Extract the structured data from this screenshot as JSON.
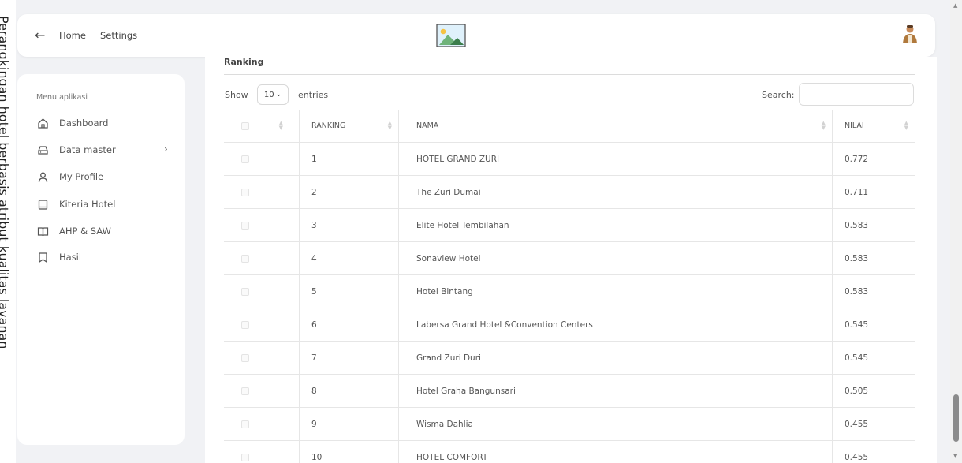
{
  "side_text": "Perangkingan hotel berbasis atribut kualitas layanan",
  "header": {
    "nav": {
      "home": "Home",
      "settings": "Settings"
    }
  },
  "sidebar": {
    "title": "Menu aplikasi",
    "items": [
      {
        "label": "Dashboard",
        "icon": "home-icon"
      },
      {
        "label": "Data master",
        "icon": "drive-icon",
        "has_submenu": true
      },
      {
        "label": "My Profile",
        "icon": "user-icon"
      },
      {
        "label": "Kiteria Hotel",
        "icon": "tablet-icon"
      },
      {
        "label": "AHP & SAW",
        "icon": "book-open-icon"
      },
      {
        "label": "Hasil",
        "icon": "bookmark-icon"
      }
    ]
  },
  "content": {
    "section_title": "Ranking",
    "show_label": "Show",
    "entries_value": "10",
    "entries_label": "entries",
    "search_label": "Search:",
    "columns": [
      "RANKING",
      "NAMA",
      "NILAI"
    ],
    "rows": [
      {
        "ranking": "1",
        "nama": "HOTEL GRAND ZURI",
        "nilai": "0.772"
      },
      {
        "ranking": "2",
        "nama": "The Zuri Dumai",
        "nilai": "0.711"
      },
      {
        "ranking": "3",
        "nama": "Elite Hotel Tembilahan",
        "nilai": "0.583"
      },
      {
        "ranking": "4",
        "nama": "Sonaview Hotel",
        "nilai": "0.583"
      },
      {
        "ranking": "5",
        "nama": "Hotel Bintang",
        "nilai": "0.583"
      },
      {
        "ranking": "6",
        "nama": "Labersa Grand Hotel &Convention Centers",
        "nilai": "0.545"
      },
      {
        "ranking": "7",
        "nama": "Grand Zuri Duri",
        "nilai": "0.545"
      },
      {
        "ranking": "8",
        "nama": "Hotel Graha Bangunsari",
        "nilai": "0.505"
      },
      {
        "ranking": "9",
        "nama": "Wisma Dahlia",
        "nilai": "0.455"
      },
      {
        "ranking": "10",
        "nama": "HOTEL COMFORT",
        "nilai": "0.455"
      }
    ]
  }
}
